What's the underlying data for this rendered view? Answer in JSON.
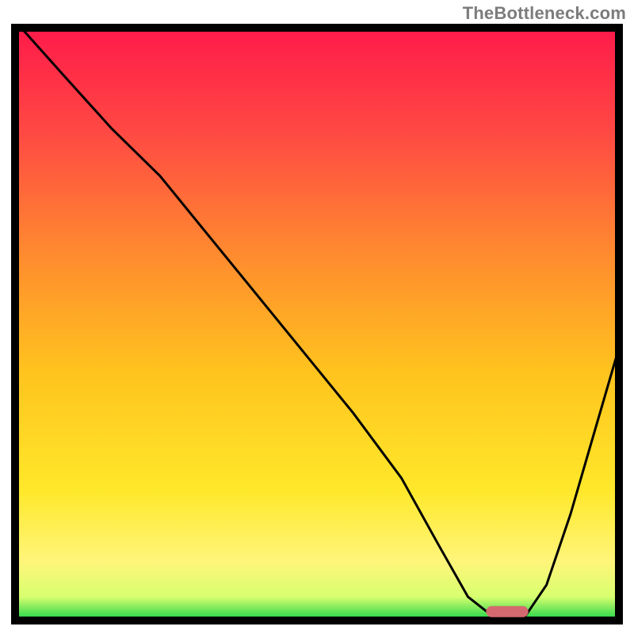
{
  "watermark": "TheBottleneck.com",
  "colors": {
    "gradient": [
      "#ff1a4a",
      "#ff4a43",
      "#ff8a2f",
      "#ffc31e",
      "#ffe82a",
      "#fff57a",
      "#d8ff70",
      "#18d247"
    ],
    "curve": "#000000",
    "pill": "#d46a6f",
    "frame": "#000000"
  },
  "chart_data": {
    "type": "line",
    "title": "",
    "xlabel": "",
    "ylabel": "",
    "xlim": [
      0,
      100
    ],
    "ylim": [
      0,
      100
    ],
    "x": [
      1,
      8,
      16,
      24,
      32,
      40,
      48,
      56,
      64,
      70,
      75,
      80,
      84,
      88,
      92,
      96,
      100
    ],
    "values": [
      100,
      92,
      83,
      75,
      65,
      55,
      45,
      35,
      24,
      13,
      4,
      0,
      0,
      6,
      18,
      32,
      46
    ],
    "optimal_range_x": [
      78,
      85
    ],
    "optimal_y": 1.5
  }
}
